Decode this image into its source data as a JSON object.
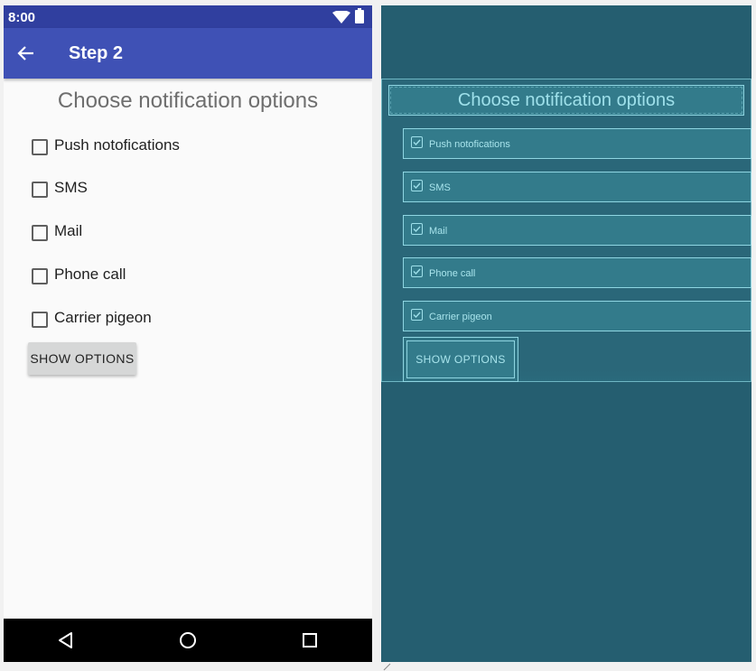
{
  "status_bar": {
    "time": "8:00",
    "icons": [
      "wifi-icon",
      "battery-icon"
    ]
  },
  "app_bar": {
    "title": "Step 2",
    "back_icon": "arrow-back-icon",
    "color": "#3f51b5",
    "status_color": "#303f9f"
  },
  "content": {
    "heading": "Choose notification options",
    "options": [
      {
        "label": "Push notofications",
        "checked": false
      },
      {
        "label": "SMS",
        "checked": false
      },
      {
        "label": "Mail",
        "checked": false
      },
      {
        "label": "Phone call",
        "checked": false
      },
      {
        "label": "Carrier pigeon",
        "checked": false
      }
    ],
    "button_label": "SHOW OPTIONS"
  },
  "nav_bar": {
    "icons": [
      "back-triangle-icon",
      "home-circle-icon",
      "recents-square-icon"
    ]
  },
  "blueprint": {
    "heading": "Choose notification options",
    "options": [
      "Push notofications",
      "SMS",
      "Mail",
      "Phone call",
      "Carrier pigeon"
    ],
    "button_label": "SHOW OPTIONS",
    "background_color": "#255e70",
    "outline_color": "#8fd6e2"
  }
}
